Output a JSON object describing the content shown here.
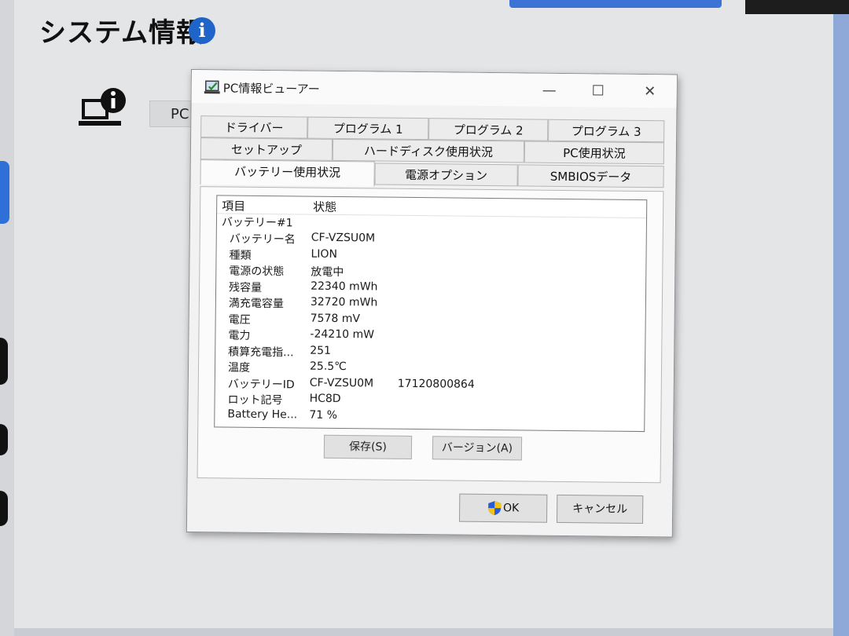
{
  "background": {
    "page_title": "システム情報",
    "info_icon": "i",
    "partial_button": "PC"
  },
  "dialog": {
    "title": "PC情報ビューアー",
    "controls": {
      "minimize": "—",
      "maximize": "☐",
      "close": "✕"
    },
    "tabs_row1": [
      "ドライバー",
      "プログラム 1",
      "プログラム 2",
      "プログラム 3"
    ],
    "tabs_row2": [
      "セットアップ",
      "ハードディスク使用状況",
      "PC使用状況"
    ],
    "tabs_row3": [
      "バッテリー使用状況",
      "電源オプション",
      "SMBIOSデータ"
    ],
    "active_tab": "バッテリー使用状況",
    "list": {
      "col_item": "項目",
      "col_status": "状態",
      "group": "バッテリー#1",
      "rows": [
        {
          "item": "バッテリー名",
          "value": "CF-VZSU0M",
          "extra": ""
        },
        {
          "item": "種類",
          "value": "LION",
          "extra": ""
        },
        {
          "item": "電源の状態",
          "value": "放電中",
          "extra": ""
        },
        {
          "item": "残容量",
          "value": "22340 mWh",
          "extra": ""
        },
        {
          "item": "満充電容量",
          "value": "32720 mWh",
          "extra": ""
        },
        {
          "item": "電圧",
          "value": "7578 mV",
          "extra": ""
        },
        {
          "item": "電力",
          "value": "-24210 mW",
          "extra": ""
        },
        {
          "item": "積算充電指...",
          "value": "251",
          "extra": ""
        },
        {
          "item": "温度",
          "value": "25.5℃",
          "extra": ""
        },
        {
          "item": "バッテリーID",
          "value": "CF-VZSU0M",
          "extra": "17120800864"
        },
        {
          "item": "ロット記号",
          "value": "HC8D",
          "extra": ""
        },
        {
          "item": "Battery He...",
          "value": "71 %",
          "extra": ""
        }
      ]
    },
    "save_button": "保存(S)",
    "version_button": "バージョン(A)",
    "ok_button": "OK",
    "cancel_button": "キャンセル"
  },
  "colors": {
    "accent": "#1f64c8",
    "dialog_bg": "#f2f2f2",
    "shield_blue": "#2a5bd7",
    "shield_yellow": "#f2c318"
  }
}
